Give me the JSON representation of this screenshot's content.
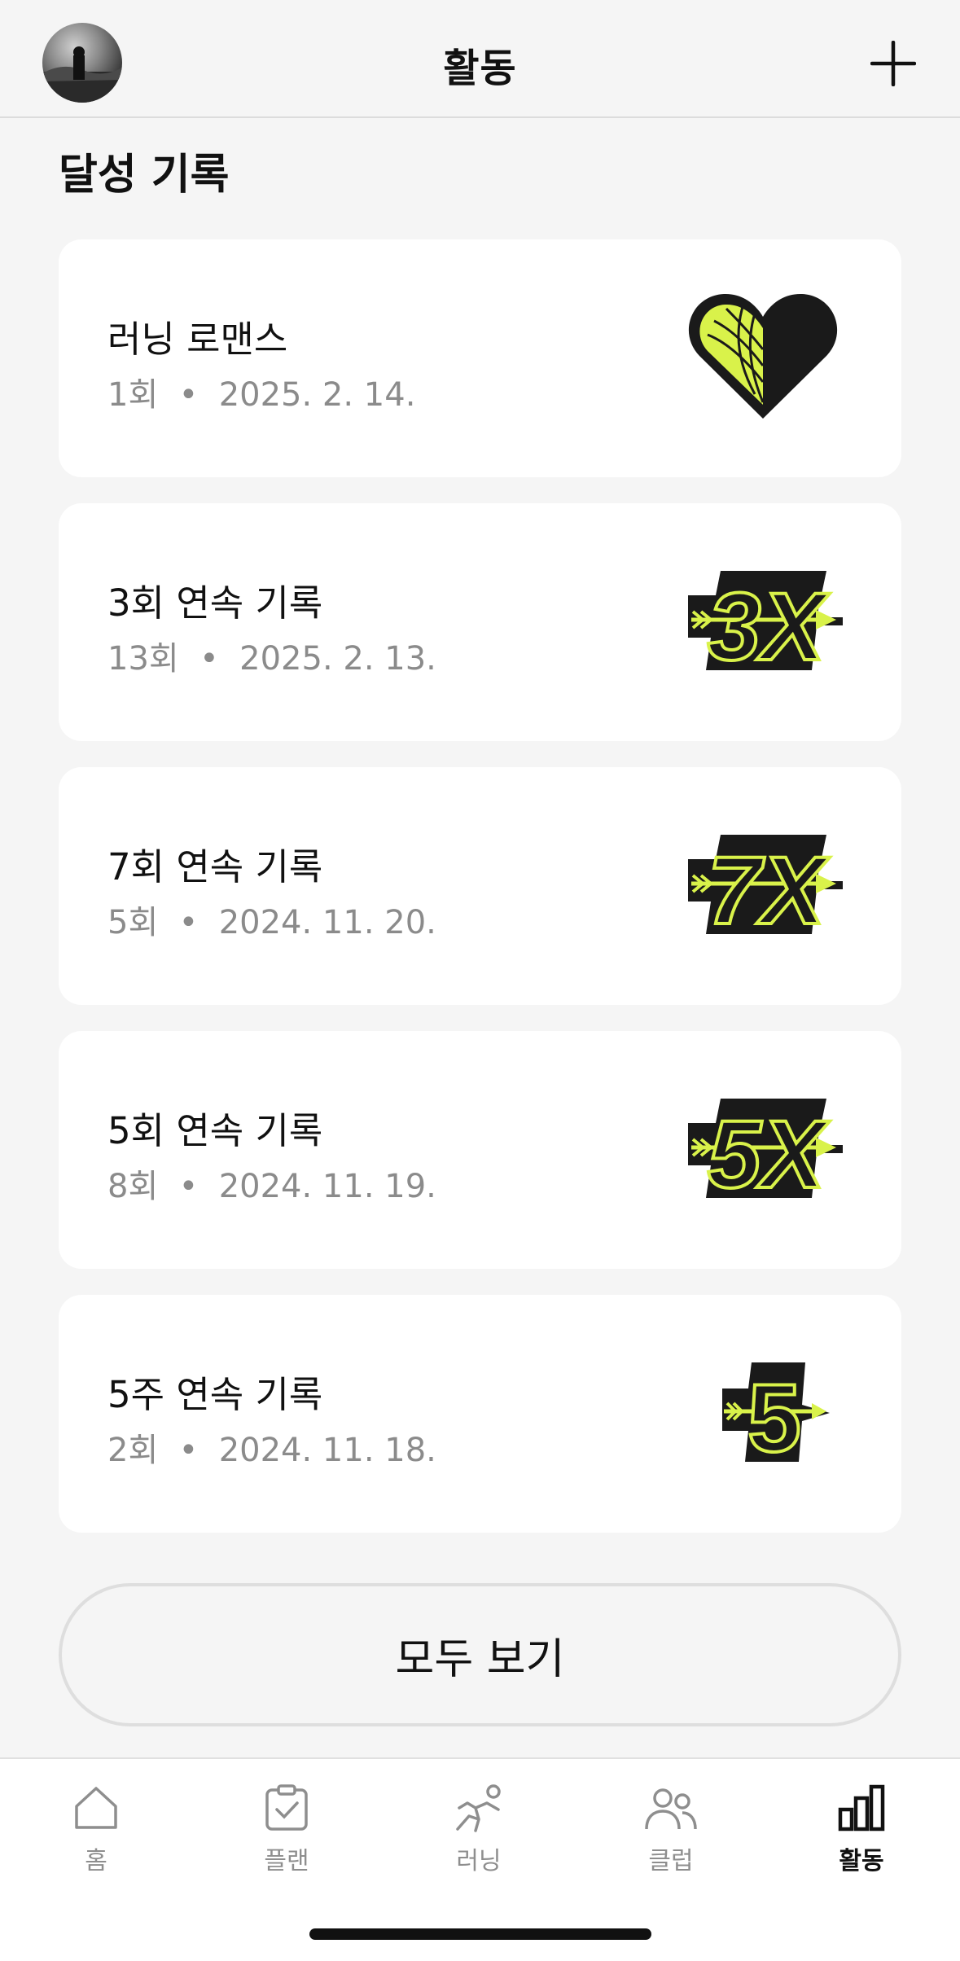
{
  "header": {
    "title": "활동",
    "avatar_icon": "profile-photo",
    "add_icon": "plus-icon"
  },
  "section": {
    "title": "달성 기록"
  },
  "achievements": [
    {
      "title": "러닝 로맨스",
      "meta": "1회  •  2025. 2. 14.",
      "badge": "heart-badge"
    },
    {
      "title": "3회 연속 기록",
      "meta": "13회  •  2025. 2. 13.",
      "badge": "3x-badge",
      "badge_text": "3X"
    },
    {
      "title": "7회 연속 기록",
      "meta": "5회  •  2024. 11. 20.",
      "badge": "7x-badge",
      "badge_text": "7X"
    },
    {
      "title": "5회 연속 기록",
      "meta": "8회  •  2024. 11. 19.",
      "badge": "5x-badge",
      "badge_text": "5X"
    },
    {
      "title": "5주 연속 기록",
      "meta": "2회  •  2024. 11. 18.",
      "badge": "5-week-badge",
      "badge_text": "5"
    }
  ],
  "view_all_label": "모두 보기",
  "tabs": [
    {
      "label": "홈",
      "icon": "home-icon",
      "active": false
    },
    {
      "label": "플랜",
      "icon": "clipboard-check-icon",
      "active": false
    },
    {
      "label": "러닝",
      "icon": "runner-icon",
      "active": false
    },
    {
      "label": "클럽",
      "icon": "people-icon",
      "active": false
    },
    {
      "label": "활동",
      "icon": "bar-chart-icon",
      "active": true
    }
  ],
  "colors": {
    "badge_accent": "#d9f24a",
    "badge_dark": "#1a1a1a",
    "background": "#f5f5f5",
    "card": "#ffffff",
    "meta_text": "#8b8b8b"
  }
}
